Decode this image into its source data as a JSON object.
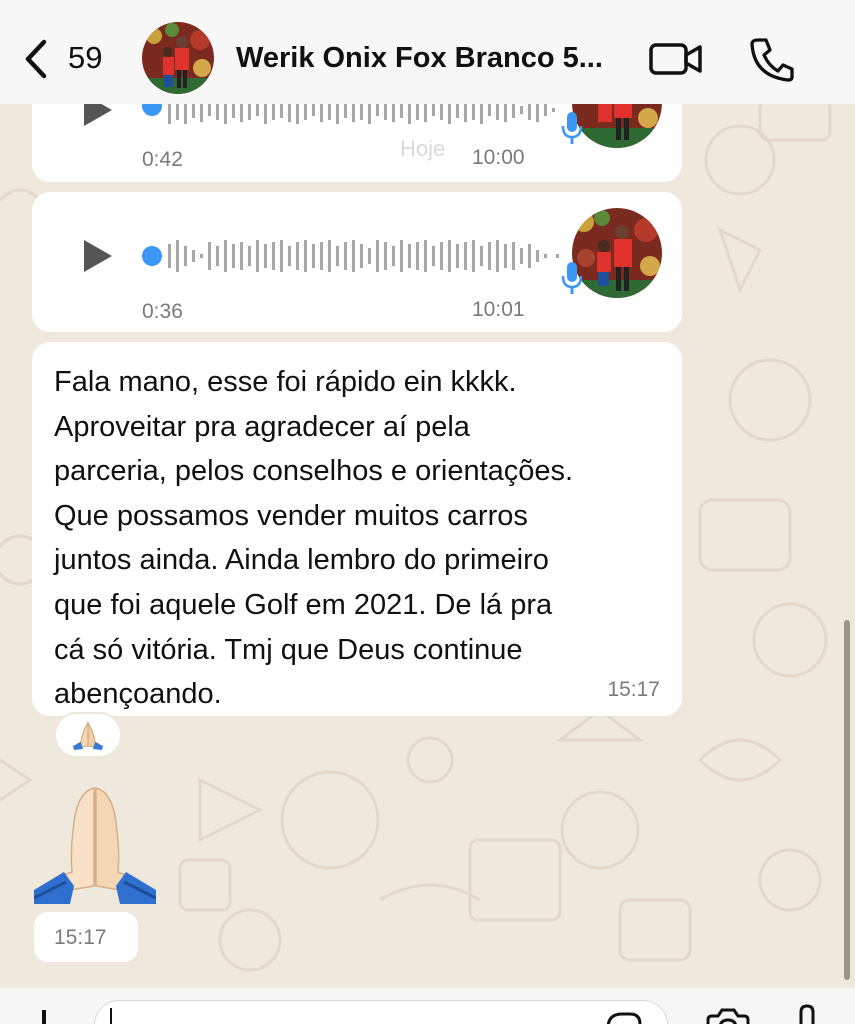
{
  "header": {
    "back_count": "59",
    "contact_name": "Werik Onix Fox Branco 5...",
    "icons": [
      "chevron-left-icon",
      "video-camera-icon",
      "phone-icon"
    ]
  },
  "messages": {
    "audio1": {
      "duration": "0:42",
      "time": "10:00"
    },
    "date_separator": "Hoje",
    "audio2": {
      "duration": "0:36",
      "time": "10:01"
    },
    "text": {
      "body": "Fala mano, esse foi rápido ein kkkk.\nAproveitar pra agradecer aí pela\nparceria, pelos conselhos e orientações.\nQue possamos vender muitos carros\njuntos ainda. Ainda lembro do primeiro\nque foi aquele Golf em 2021. De lá pra\ncá só vitória. Tmj que Deus continue\nabençoando.",
      "time": "15:17",
      "reaction": "🙏"
    },
    "emoji": {
      "glyph": "🙏",
      "time": "15:17"
    }
  },
  "colors": {
    "wallpaper": "#efe8dd",
    "bubble": "#ffffff",
    "accent_blue": "#3b97f5",
    "header": "#f7f7f7"
  }
}
